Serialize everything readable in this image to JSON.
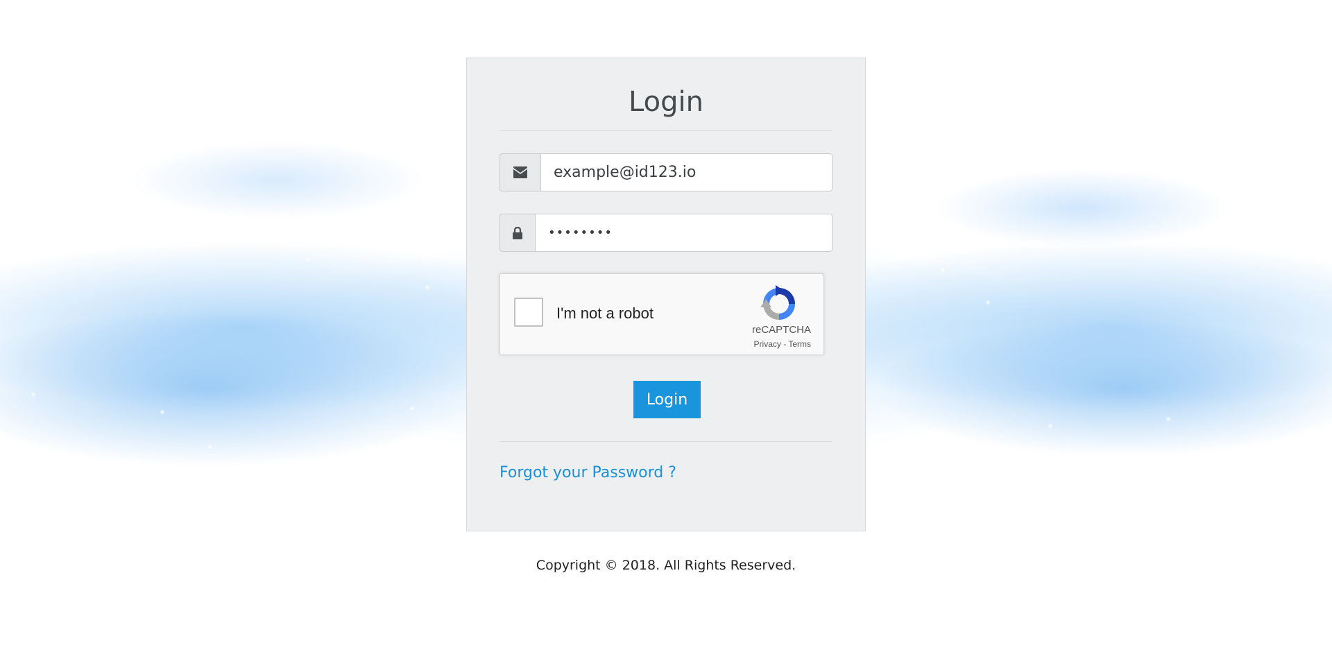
{
  "login": {
    "title": "Login",
    "email": {
      "value": "example@id123.io",
      "icon": "envelope-icon"
    },
    "password": {
      "value": "••••••••",
      "icon": "lock-icon"
    },
    "recaptcha": {
      "label": "I'm not a robot",
      "brand": "reCAPTCHA",
      "privacy": "Privacy",
      "separator": " - ",
      "terms": "Terms"
    },
    "submit_label": "Login",
    "forgot_link": "Forgot your Password ?"
  },
  "footer": {
    "copyright": "Copyright © 2018. All Rights Reserved."
  },
  "colors": {
    "accent": "#1895dc",
    "link": "#1891d8",
    "card_bg": "#eeeff0"
  }
}
